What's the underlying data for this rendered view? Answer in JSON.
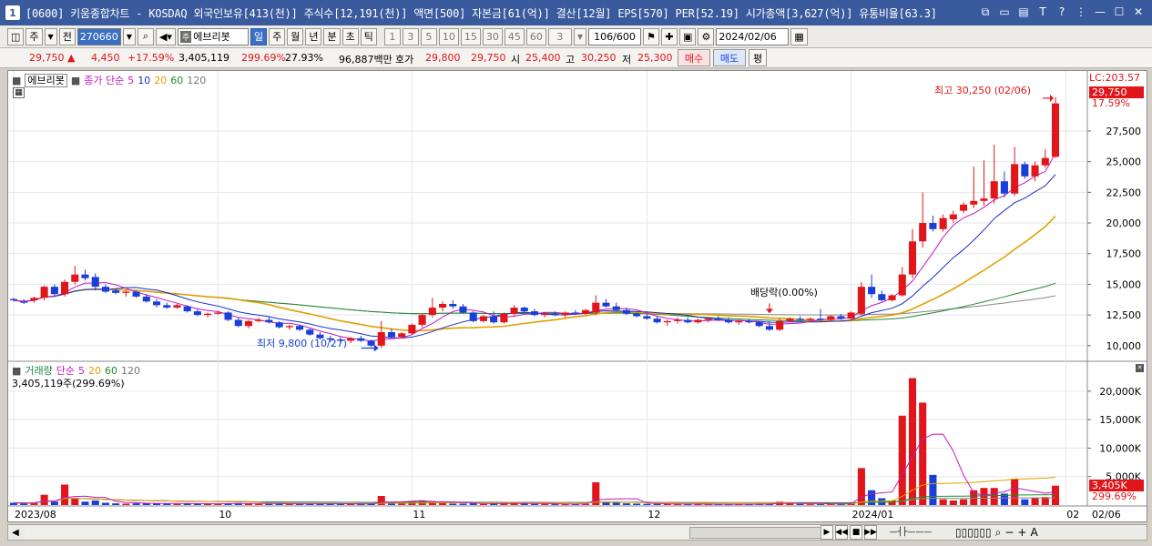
{
  "window": {
    "badge": "1",
    "title": "[0600] 키움종합차트 - KOSDAQ 외국인보유[413(천)] 주식수[12,191(천)] 액면[500] 자본금[61(억)] 결산[12월] EPS[570] PER[52.19] 시가총액[3,627(억)] 유통비율[63.3]"
  },
  "toolbar": {
    "type_label": "주",
    "prev_label": "전",
    "code_value": "270660",
    "stock_tag": "주",
    "stock_name": "에브리봇",
    "periods": [
      "일",
      "주",
      "월",
      "년",
      "분",
      "초",
      "틱"
    ],
    "active_period": "일",
    "intervals": [
      "1",
      "3",
      "5",
      "10",
      "15",
      "30",
      "45",
      "60"
    ],
    "interval_select": "3",
    "count": "106/600",
    "date": "2024/02/06"
  },
  "quote": {
    "price": "29,750",
    "change": "4,450",
    "change_pct": "+17.59%",
    "volume": "3,405,119",
    "volume_ratio": "299.69%",
    "turnover": "27.93%",
    "amount": "96,887백만",
    "hoga_label": "호가",
    "ask": "29,800",
    "bid": "29,750",
    "open_label": "시",
    "open": "25,400",
    "high_label": "고",
    "high": "30,250",
    "low_label": "저",
    "low": "25,300",
    "buy_label": "매수",
    "sell_label": "매도",
    "even_label": "평"
  },
  "chart": {
    "price_legend": {
      "name": "에브리봇",
      "series": "종가 단순",
      "periods": [
        "5",
        "10",
        "20",
        "60",
        "120"
      ]
    },
    "volume_legend": {
      "name": "거래량",
      "series": "단순",
      "periods": [
        "5",
        "20",
        "60",
        "120"
      ],
      "current": "3,405,119주(299.69%)"
    },
    "lc_label": "LC:203.57",
    "last_price_tag": "29,750",
    "last_pct_tag": "17.59%",
    "high_annot": "최고 30,250 (02/06)",
    "low_annot": "최저 9,800 (10/27)",
    "div_annot": "배당락(0.00%)",
    "vol_tag": "3,405K",
    "vol_pct_tag": "299.69%",
    "x_labels": [
      "2023/08",
      "10",
      "11",
      "12",
      "2024/01",
      "02",
      "02/06"
    ]
  },
  "chart_data": {
    "type": "candlestick",
    "price_axis": {
      "ticks": [
        10000,
        12500,
        15000,
        17500,
        20000,
        22500,
        25000,
        27500
      ],
      "ylim": [
        8800,
        31800
      ]
    },
    "volume_axis": {
      "ticks": [
        5000,
        10000,
        15000,
        20000
      ],
      "unit": "K",
      "ylim": [
        0,
        23500
      ]
    },
    "candles": [
      [
        13800,
        13900,
        13600,
        13700,
        400
      ],
      [
        13600,
        13800,
        13400,
        13500,
        300
      ],
      [
        13700,
        14000,
        13500,
        13900,
        350
      ],
      [
        13900,
        14900,
        13700,
        14800,
        1800
      ],
      [
        14800,
        15000,
        14000,
        14200,
        600
      ],
      [
        14200,
        15400,
        14000,
        15200,
        3600
      ],
      [
        15200,
        16500,
        15000,
        15800,
        1200
      ],
      [
        15800,
        16200,
        15300,
        15500,
        600
      ],
      [
        15600,
        15900,
        14500,
        14800,
        800
      ],
      [
        14800,
        15000,
        14300,
        14400,
        400
      ],
      [
        14500,
        14700,
        14200,
        14300,
        300
      ],
      [
        14300,
        14500,
        14000,
        14400,
        250
      ],
      [
        14400,
        14500,
        13900,
        14000,
        300
      ],
      [
        14000,
        14200,
        13500,
        13600,
        350
      ],
      [
        13600,
        13800,
        13100,
        13300,
        300
      ],
      [
        13300,
        13500,
        13000,
        13100,
        250
      ],
      [
        13100,
        13400,
        13000,
        13300,
        200
      ],
      [
        13200,
        13300,
        12700,
        12800,
        250
      ],
      [
        12800,
        13000,
        12400,
        12500,
        300
      ],
      [
        12500,
        12700,
        12300,
        12600,
        200
      ],
      [
        12600,
        12800,
        12500,
        12700,
        200
      ],
      [
        12700,
        12800,
        12000,
        12100,
        300
      ],
      [
        12100,
        12300,
        11500,
        11600,
        350
      ],
      [
        11600,
        12100,
        11400,
        12000,
        300
      ],
      [
        12000,
        12300,
        11900,
        12100,
        200
      ],
      [
        12100,
        12400,
        11800,
        11900,
        200
      ],
      [
        11900,
        12000,
        11400,
        11500,
        250
      ],
      [
        11500,
        11700,
        11300,
        11600,
        200
      ],
      [
        11600,
        11700,
        11200,
        11300,
        200
      ],
      [
        11300,
        11400,
        10800,
        10900,
        250
      ],
      [
        10900,
        11100,
        10500,
        10600,
        250
      ],
      [
        10600,
        10800,
        10300,
        10500,
        250
      ],
      [
        10500,
        10700,
        10200,
        10400,
        200
      ],
      [
        10400,
        10700,
        10200,
        10600,
        200
      ],
      [
        10600,
        10800,
        10300,
        10400,
        150
      ],
      [
        10400,
        10500,
        9900,
        10000,
        250
      ],
      [
        10000,
        12000,
        9800,
        11100,
        1600
      ],
      [
        11100,
        11400,
        10600,
        10700,
        500
      ],
      [
        10700,
        11100,
        10600,
        11000,
        300
      ],
      [
        11000,
        11800,
        10900,
        11700,
        700
      ],
      [
        11700,
        12600,
        11500,
        12500,
        800
      ],
      [
        12500,
        13900,
        12300,
        13100,
        700
      ],
      [
        13100,
        13600,
        12800,
        13400,
        350
      ],
      [
        13400,
        13700,
        13000,
        13200,
        250
      ],
      [
        13200,
        13400,
        12600,
        12700,
        250
      ],
      [
        12700,
        12800,
        11900,
        12000,
        300
      ],
      [
        12000,
        12500,
        11900,
        12400,
        200
      ],
      [
        12400,
        12800,
        11800,
        11900,
        250
      ],
      [
        11900,
        12700,
        11800,
        12600,
        300
      ],
      [
        12600,
        13300,
        12400,
        13100,
        400
      ],
      [
        13100,
        13200,
        12700,
        12800,
        250
      ],
      [
        12800,
        13000,
        12400,
        12500,
        200
      ],
      [
        12500,
        12700,
        12300,
        12600,
        200
      ],
      [
        12600,
        12800,
        12400,
        12500,
        150
      ],
      [
        12500,
        12800,
        12300,
        12700,
        150
      ],
      [
        12700,
        12900,
        12500,
        12600,
        150
      ],
      [
        12600,
        13000,
        12500,
        12900,
        200
      ],
      [
        12700,
        14100,
        12500,
        13500,
        4000
      ],
      [
        13500,
        13800,
        13100,
        13200,
        600
      ],
      [
        13200,
        13500,
        12800,
        12900,
        400
      ],
      [
        12900,
        13100,
        12500,
        12600,
        300
      ],
      [
        12600,
        12700,
        12300,
        12400,
        250
      ],
      [
        12400,
        12600,
        12100,
        12200,
        200
      ],
      [
        12200,
        12400,
        11800,
        11900,
        200
      ],
      [
        11900,
        12100,
        11600,
        12000,
        200
      ],
      [
        12000,
        12300,
        11800,
        12100,
        150
      ],
      [
        12100,
        12300,
        11800,
        11900,
        150
      ],
      [
        11900,
        12200,
        11800,
        12100,
        150
      ],
      [
        12100,
        12300,
        11900,
        12200,
        150
      ],
      [
        12200,
        12400,
        12000,
        12100,
        150
      ],
      [
        12100,
        12300,
        11800,
        11900,
        150
      ],
      [
        11900,
        12100,
        11700,
        12000,
        150
      ],
      [
        12000,
        12200,
        11800,
        11900,
        150
      ],
      [
        11900,
        12000,
        11500,
        11600,
        200
      ],
      [
        11600,
        12000,
        11200,
        11300,
        250
      ],
      [
        11300,
        12200,
        11200,
        12000,
        600
      ],
      [
        12000,
        12300,
        11900,
        12200,
        300
      ],
      [
        12200,
        12400,
        12000,
        12100,
        200
      ],
      [
        12100,
        12300,
        11900,
        12200,
        150
      ],
      [
        12200,
        13000,
        12000,
        12100,
        300
      ],
      [
        12100,
        12500,
        12000,
        12400,
        200
      ],
      [
        12400,
        12600,
        12100,
        12200,
        150
      ],
      [
        12200,
        12800,
        12100,
        12700,
        300
      ],
      [
        12600,
        15200,
        12500,
        14800,
        6500
      ],
      [
        14800,
        15800,
        13900,
        14200,
        2600
      ],
      [
        14200,
        14500,
        13600,
        13700,
        1200
      ],
      [
        13700,
        14200,
        13600,
        14100,
        800
      ],
      [
        14100,
        16400,
        14000,
        15800,
        15700
      ],
      [
        15800,
        19500,
        15500,
        18500,
        22300
      ],
      [
        18500,
        22500,
        18000,
        20000,
        18000
      ],
      [
        20000,
        20600,
        19300,
        19500,
        5300
      ],
      [
        19500,
        20700,
        19300,
        20400,
        1000
      ],
      [
        20300,
        21000,
        20000,
        20700,
        800
      ],
      [
        21000,
        21700,
        20800,
        21500,
        1000
      ],
      [
        21500,
        24600,
        21200,
        21800,
        2600
      ],
      [
        21800,
        25100,
        21400,
        22000,
        3000
      ],
      [
        22000,
        26400,
        21600,
        23400,
        3000
      ],
      [
        23400,
        24200,
        22100,
        22400,
        2000
      ],
      [
        22400,
        26200,
        22200,
        24800,
        4600
      ],
      [
        24800,
        25000,
        23600,
        23800,
        1000
      ],
      [
        23800,
        25000,
        23400,
        24700,
        1300
      ],
      [
        24700,
        26000,
        24500,
        25300,
        1400
      ],
      [
        25400,
        30250,
        25300,
        29750,
        3405
      ]
    ]
  }
}
